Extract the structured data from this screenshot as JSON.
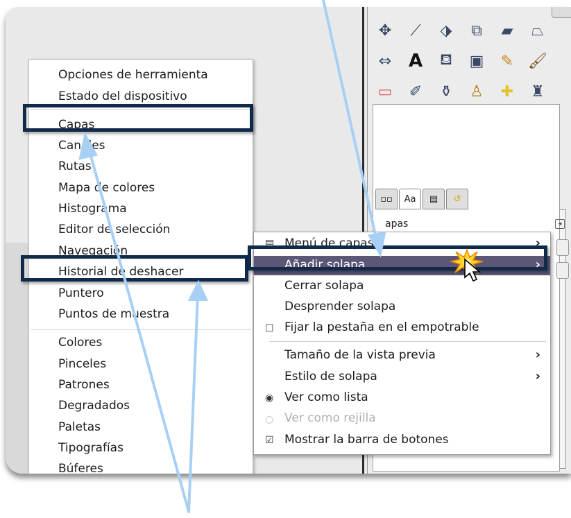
{
  "dialog_menu": {
    "items": [
      {
        "label": "Opciones de herramienta"
      },
      {
        "label": "Estado del dispositivo"
      },
      {
        "label": "Capas"
      },
      {
        "label": "Canales"
      },
      {
        "label": "Rutas"
      },
      {
        "label": "Mapa de colores"
      },
      {
        "label": "Histograma"
      },
      {
        "label": "Editor de selección"
      },
      {
        "label": "Navegación"
      },
      {
        "label": "Historial de deshacer"
      },
      {
        "label": "Puntero"
      },
      {
        "label": "Puntos de muestra"
      },
      {
        "label": "Colores"
      },
      {
        "label": "Pinceles"
      },
      {
        "label": "Patrones"
      },
      {
        "label": "Degradados"
      },
      {
        "label": "Paletas"
      },
      {
        "label": "Tipografías"
      },
      {
        "label": "Búferes"
      }
    ]
  },
  "context_menu": {
    "items": [
      {
        "label": "Menú de capas",
        "icon": "layers-menu-icon",
        "submenu": true
      },
      {
        "label": "Añadir solapa",
        "submenu": true,
        "highlighted": true
      },
      {
        "label": "Cerrar solapa"
      },
      {
        "label": "Desprender solapa"
      },
      {
        "label": "Fijar la pestaña en el empotrable",
        "checkbox": false
      },
      {
        "label": "Tamaño de la vista previa",
        "submenu": true
      },
      {
        "label": "Estilo de solapa",
        "submenu": true
      },
      {
        "label": "Ver como lista",
        "radio": true
      },
      {
        "label": "Ver como rejilla",
        "radio": false,
        "disabled": true
      },
      {
        "label": "Mostrar la barra de botones",
        "checkbox": true
      }
    ]
  },
  "toolbox": {
    "dock_tab_text": "Aa",
    "dock_cut_label": "apas",
    "colors": {
      "foreground": "#0a3161",
      "background": "#ffffff"
    }
  },
  "annotation_color": "#0f2a4a",
  "arrow_color": "#a8d0f5"
}
